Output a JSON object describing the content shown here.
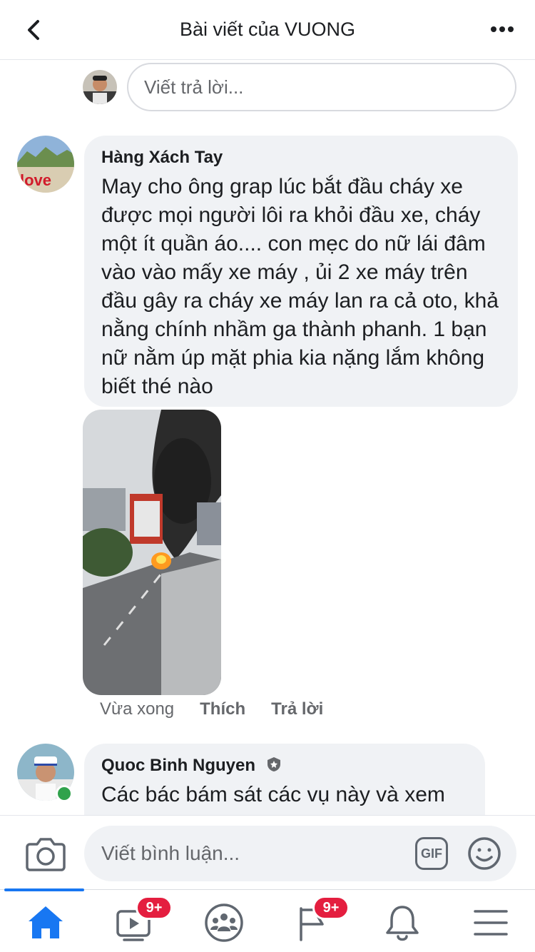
{
  "header": {
    "title": "Bài viết của VUONG",
    "back_icon": "chevron-left-icon",
    "more_icon": "more-horizontal-icon"
  },
  "reply": {
    "placeholder": "Viết trả lời..."
  },
  "comments": [
    {
      "author": "Hàng Xách Tay",
      "text": "May cho ông grap lúc bắt đầu cháy xe được mọi người lôi ra khỏi đầu xe, cháy một ít quần áo.... con mẹc do nữ lái đâm vào vào mấy xe máy , ủi 2 xe máy trên đầu gây ra cháy xe máy lan ra cả oto, khả nằng chính nhầm ga thành phanh. 1 bạn nữ nằm úp mặt phia kia nặng lắm không biết thé nào",
      "time": "Vừa xong",
      "like_label": "Thích",
      "reply_label": "Trả lời"
    },
    {
      "author": "Quoc Binh Nguyen",
      "text": "Các bác bám sát các vụ này và xem"
    }
  ],
  "composer": {
    "placeholder": "Viết bình luận...",
    "gif_label": "GIF"
  },
  "nav": {
    "video_badge": "9+",
    "pages_badge": "9+"
  },
  "colors": {
    "accent": "#1877f2",
    "badge": "#e41e3f",
    "bubble": "#f0f2f5",
    "online": "#31a24c"
  }
}
